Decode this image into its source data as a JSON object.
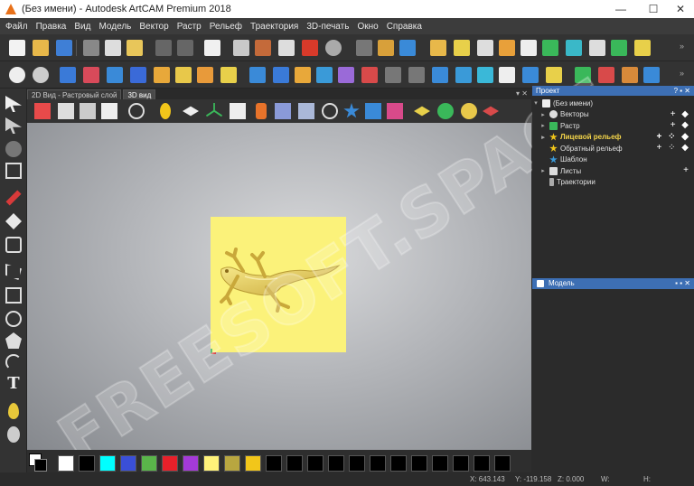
{
  "window": {
    "title": "(Без имени) - Autodesk ArtCAM Premium 2018",
    "controls": [
      "—",
      "☐",
      "✕"
    ]
  },
  "menu": [
    "Файл",
    "Правка",
    "Вид",
    "Модель",
    "Вектор",
    "Растр",
    "Рельеф",
    "Траектория",
    "3D-печать",
    "Окно",
    "Справка"
  ],
  "view": {
    "tabs": [
      {
        "label": "2D Вид - Растровый слой",
        "active": false
      },
      {
        "label": "3D вид",
        "active": true
      }
    ],
    "pin": "▾ ✕",
    "watermark": "FREESOFT.SPACE"
  },
  "project_panel": {
    "title": "Проект",
    "controls": "? ▪ ✕",
    "root": "(Без имени)",
    "items": [
      {
        "label": "Векторы",
        "actions": "+ ◆"
      },
      {
        "label": "Растр",
        "actions": "+ ◆"
      },
      {
        "label": "Лицевой рельеф",
        "actions": "+ ⁘ ◆",
        "bold": true
      },
      {
        "label": "Обратный рельеф",
        "actions": "+ ⁘ ◆"
      },
      {
        "label": "Шаблон",
        "actions": ""
      },
      {
        "label": "Листы",
        "actions": "+"
      },
      {
        "label": "Траектории",
        "actions": ""
      }
    ]
  },
  "model_panel": {
    "title": "Модель",
    "controls": "▪ ▪ ✕"
  },
  "palette_colors": [
    "#ffffff",
    "#000000",
    "#00ffff",
    "#3a4fd8",
    "#5ab54a",
    "#e8202a",
    "#a43ad8",
    "#fff27a",
    "#b8a640",
    "#f2c61a",
    "#000000",
    "#000000",
    "#000000",
    "#000000",
    "#000000",
    "#000000",
    "#000000",
    "#000000",
    "#000000",
    "#000000",
    "#000000",
    "#000000"
  ],
  "status": {
    "x": "X: 643.143",
    "y": "Y: -119.158",
    "z": "Z: 0.000",
    "w": "W:",
    "h": "H:"
  }
}
